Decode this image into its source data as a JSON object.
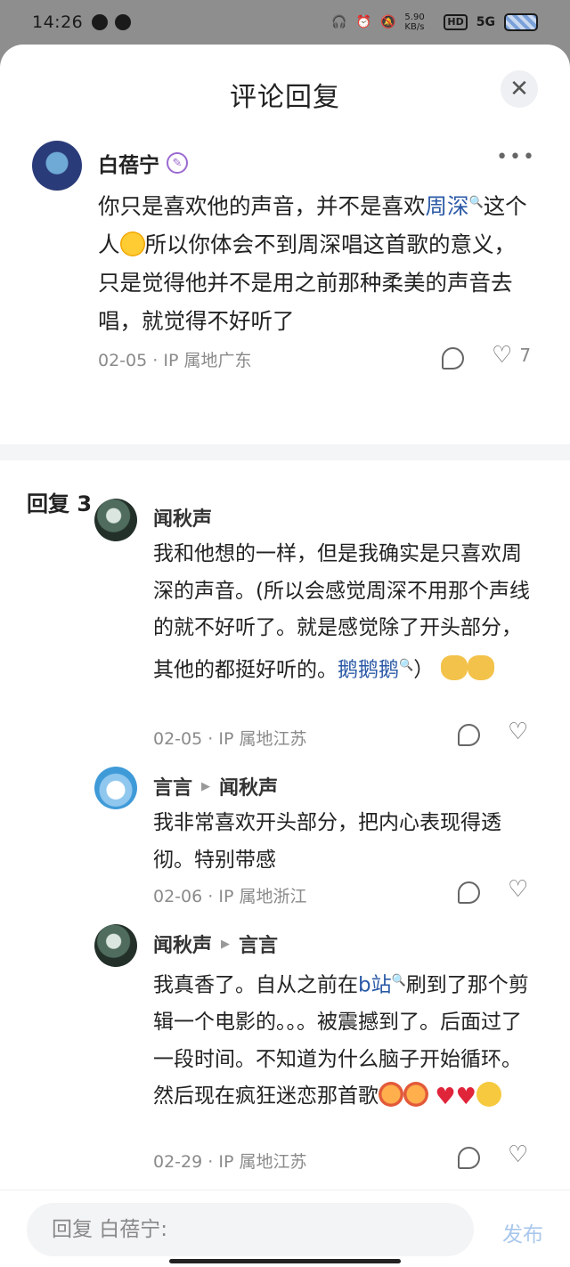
{
  "status_bar": {
    "time": "14:26",
    "net_speed": "5.90 KB/s",
    "hd": "HD",
    "signal": "5G"
  },
  "sheet": {
    "title": "评论回复",
    "close_icon": "close-icon"
  },
  "main_comment": {
    "user": "白蓓宁",
    "text_before_link": "你只是喜欢他的声音，并不是喜欢",
    "link": "周深",
    "text_after_link_1": "这个人",
    "text_after_emoji": "所以你体会不到周深唱这首歌的意义，只是觉得他并不是用之前那种柔美的声音去唱，就觉得不好听了",
    "date": "02-05",
    "ip": "IP 属地广东",
    "likes": "7"
  },
  "replies_header": "回复 3",
  "replies": [
    {
      "user": "闻秋声",
      "reply_to": "",
      "text": "我和他想的一样，但是我确实是只喜欢周深的声音。(所以会感觉周深不用那个声线的就不好听了。就是感觉除了开头部分，其他的都挺好听的。",
      "link": "鹅鹅鹅",
      "text_tail": "）",
      "date": "02-05",
      "ip": "IP 属地江苏"
    },
    {
      "user": "言言",
      "reply_to": "闻秋声",
      "text": "我非常喜欢开头部分，把内心表现得透彻。特别带感",
      "date": "02-06",
      "ip": "IP 属地浙江"
    },
    {
      "user": "闻秋声",
      "reply_to": "言言",
      "text_before_link": "我真香了。自从之前在",
      "link": "b站",
      "text_after_link": "刷到了那个剪辑一个电影的。。。被震撼到了。后面过了一段时间。不知道为什么脑子开始循环。然后现在疯狂迷恋那首歌",
      "date": "02-29",
      "ip": "IP 属地江苏"
    }
  ],
  "bottom_bar": {
    "placeholder": "回复 白蓓宁:",
    "publish": "发布"
  }
}
